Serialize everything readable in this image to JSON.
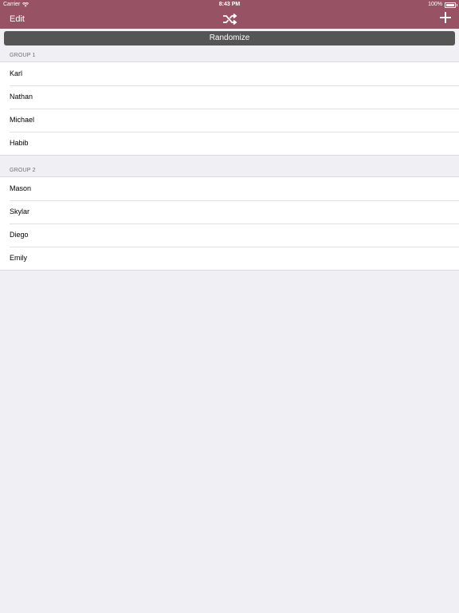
{
  "status_bar": {
    "carrier": "Carrier",
    "time": "8:43 PM",
    "battery": "100%"
  },
  "nav": {
    "edit_label": "Edit",
    "center_icon": "shuffle-icon",
    "right_icon": "plus-icon"
  },
  "randomize_label": "Randomize",
  "colors": {
    "header": "#975263",
    "button": "#555555",
    "background": "#efeff4"
  },
  "groups": [
    {
      "title": "GROUP 1",
      "members": [
        "Karl",
        "Nathan",
        "Michael",
        "Habib"
      ]
    },
    {
      "title": "GROUP 2",
      "members": [
        "Mason",
        "Skylar",
        "Diego",
        "Emily"
      ]
    }
  ]
}
